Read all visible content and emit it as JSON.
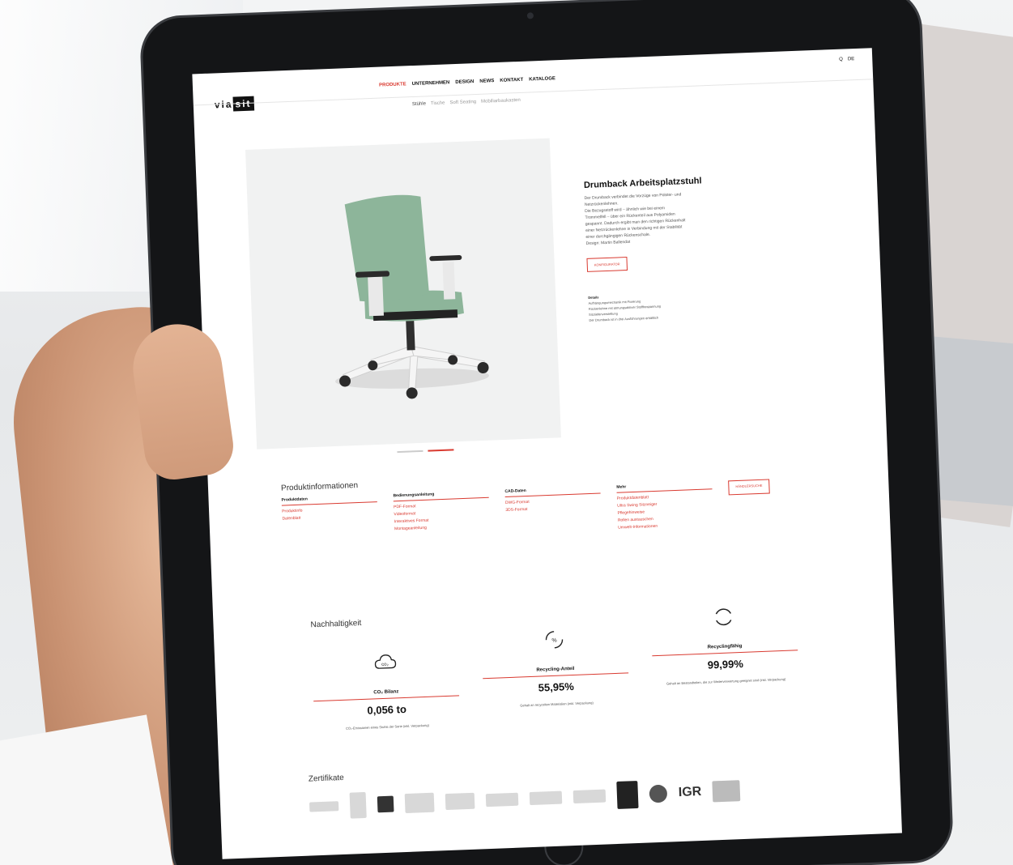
{
  "site": {
    "logo_left": "via",
    "logo_right": "sit",
    "nav": [
      "PRODUKTE",
      "UNTERNEHMEN",
      "DESIGN",
      "NEWS",
      "KONTAKT",
      "KATALOGE"
    ],
    "active_nav_index": 0,
    "util": {
      "search": "Q",
      "lang": "DE"
    },
    "subnav": [
      "Stühle",
      "Tische",
      "Soft Seating",
      "Mobiliarbaukasten"
    ]
  },
  "product": {
    "title": "Drumback Arbeitsplatzstuhl",
    "desc_lines": [
      "Der Drumback verbindet die Vorzüge von Polster- und",
      "Netzrückenlehnen.",
      "Die Bezugsstoff wird – ähnlich wie bei einem",
      "Trommelfell – über ein Rückenteil aus Polyamiden",
      "gespannt. Dadurch ergibt man den richtigen Rückenhalt",
      "einer Netzrückenlehne in Verbindung mit der Stabilität",
      "einer durchgängigen Rückenschale.",
      "Design: Martin Ballendat"
    ],
    "configure_label": "KONFIGURATOR",
    "details_title": "Details",
    "details": [
      "Aufhängungsmechanik mit Fixierung",
      "Rückenlehne mit atmungsaktiver Stoffbespannung",
      "Sitztiefenverstellung",
      "Der Drumback ist in drei Ausführungen erhältlich"
    ]
  },
  "info": {
    "title": "Produktinformationen",
    "columns": [
      {
        "head": "Produktdaten",
        "items": [
          "Produktinfo",
          "Datenblatt"
        ]
      },
      {
        "head": "Bedienungsanleitung",
        "items": [
          "PDF-Format",
          "Videoformat",
          "Interaktives Format",
          "Montageanleitung"
        ]
      },
      {
        "head": "CAD-Daten",
        "items": [
          "DWG-Format",
          "3DS-Format"
        ]
      },
      {
        "head": "Mehr",
        "items": [
          "Produktdatenblatt",
          "Ultra Swing Sitzneiger",
          "Pflegehinweise",
          "Rollen austauschen",
          "Umwelt-Informationen"
        ]
      }
    ],
    "request_label": "HÄNDLERSUCHE"
  },
  "sustainability": {
    "title": "Nachhaltigkeit",
    "metrics": [
      {
        "icon": "co2-cloud-icon",
        "label": "CO₂ Bilanz",
        "value": "0,056 to",
        "note": "CO₂-Emissionen eines Stuhls der Serie (inkl. Verpackung)"
      },
      {
        "icon": "recycling-percent-icon",
        "label": "Recycling-Anteil",
        "value": "55,95%",
        "note": "Gehalt an recycelten Materialien (inkl. Verpackung)"
      },
      {
        "icon": "recyclable-arrows-icon",
        "label": "Recyclingfähig",
        "value": "99,99%",
        "note": "Gehalt an Bestandteilen, die zur Weiterverwertung geeignet sind (inkl. Verpackung)"
      }
    ]
  },
  "certificates": {
    "title": "Zertifikate",
    "badges": [
      "IGR"
    ]
  },
  "colors": {
    "accent": "#d93a30",
    "chair_green": "#8db59a"
  }
}
